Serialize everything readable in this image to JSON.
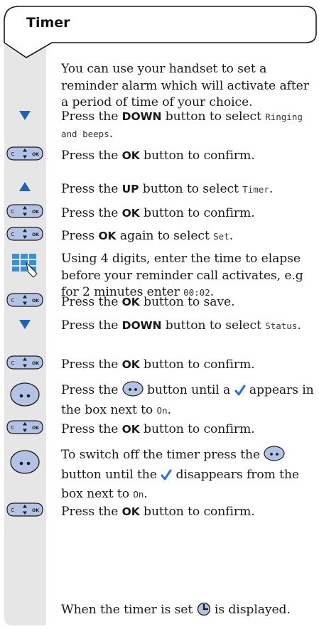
{
  "title": "Timer",
  "intro": "You can use your handset to set a reminder alarm which will activate after a period of time of your choice.",
  "steps": [
    {
      "icon": "down-arrow-icon",
      "pre": "Press the ",
      "bold": "DOWN",
      "post": " button to select ",
      "lcd": "Ringing and beeps",
      "end": "."
    },
    {
      "icon": "navigation-key-icon",
      "pre": "Press the ",
      "bold": "OK",
      "post": " button to confirm."
    },
    {
      "icon": "up-arrow-icon",
      "pre": "Press the ",
      "bold": "UP",
      "post": " button to select ",
      "lcd": "Timer",
      "end": "."
    },
    {
      "icon": "navigation-key-icon",
      "pre": "Press the ",
      "bold": "OK",
      "post": " button to confirm."
    },
    {
      "icon": "navigation-key-icon",
      "pre": "Press ",
      "bold": "OK",
      "post": " again to select ",
      "lcd": "Set",
      "end": "."
    },
    {
      "icon": "keypad-icon",
      "pre": "Using 4 digits, enter the time to elapse before your reminder call activates, e.g for 2 minutes enter ",
      "lcd": "00:02",
      "end": "."
    },
    {
      "icon": "navigation-key-icon",
      "pre": "Press the ",
      "bold": "OK",
      "post": " button to save."
    },
    {
      "icon": "down-arrow-icon",
      "pre": "Press the ",
      "bold": "DOWN",
      "post": " button to select ",
      "lcd": "Status",
      "end": "."
    },
    {
      "icon": "navigation-key-icon",
      "pre": "Press the ",
      "bold": "OK",
      "post": " button to confirm."
    },
    {
      "icon": "round-button-icon",
      "pre": "Press the ",
      "post": " button until a ",
      "post2": " appears in the box next to ",
      "lcd": "On",
      "end": "."
    },
    {
      "icon": "navigation-key-icon",
      "pre": "Press the ",
      "bold": "OK",
      "post": " button to confirm."
    },
    {
      "icon": "round-button-icon",
      "pre": "To switch off the timer press the ",
      "post": " button until the ",
      "post2": " disappears from the box next to ",
      "lcd": "On",
      "end": "."
    },
    {
      "icon": "navigation-key-icon",
      "pre": "Press the ",
      "bold": "OK",
      "post": " button to confirm."
    }
  ],
  "footer": {
    "pre": "When the timer is set ",
    "post": " is displayed."
  },
  "key_labels": {
    "left": "C",
    "right": "OK"
  },
  "colors": {
    "sidebar": "#e6e6e6",
    "accent": "#1f64b4",
    "key_fill": "#b3c3e6",
    "check": "#2a6fd6"
  }
}
